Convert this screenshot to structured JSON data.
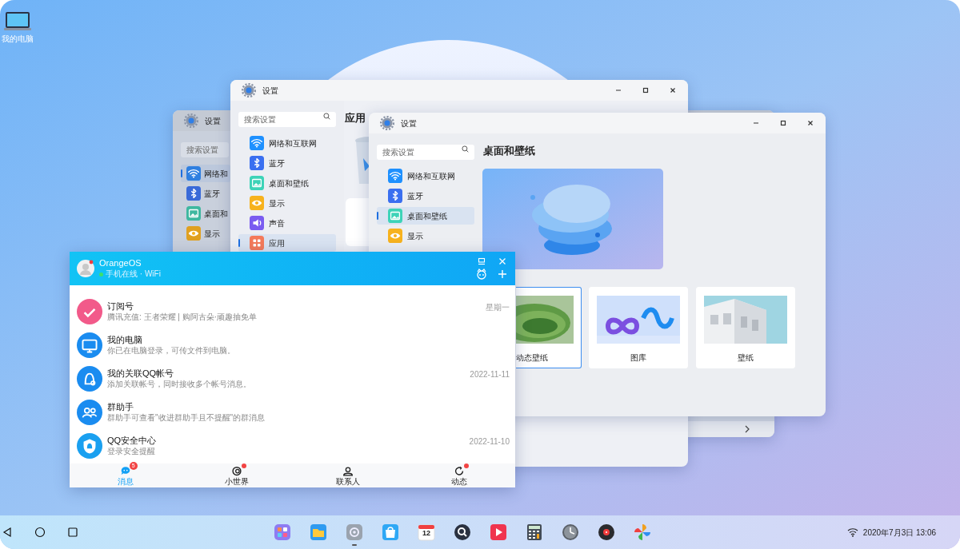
{
  "desktop_icons": [
    {
      "label": "我的电脑"
    }
  ],
  "windows": [
    {
      "title": "设置",
      "search": {
        "placeholder": "搜索设置"
      },
      "nav": [
        {
          "label": "网络和",
          "kind": "network",
          "color": "#2f7fe0",
          "selected": true
        },
        {
          "label": "蓝牙",
          "kind": "bluetooth",
          "color": "#3a6ad8",
          "selected": false
        },
        {
          "label": "桌面和",
          "kind": "wallpaper",
          "color": "#3fb8a0",
          "selected": false
        },
        {
          "label": "显示",
          "kind": "display",
          "color": "#e0a020",
          "selected": false
        }
      ],
      "footer": {
        "kind": "chevron"
      }
    },
    {
      "title": "设置",
      "search": {
        "placeholder": "搜索设置"
      },
      "nav": [
        {
          "label": "网络和互联网",
          "kind": "network",
          "color": "#1e90ff",
          "selected": false
        },
        {
          "label": "蓝牙",
          "kind": "bluetooth",
          "color": "#3a6ff0",
          "selected": false
        },
        {
          "label": "桌面和壁纸",
          "kind": "wallpaper",
          "color": "#3dd3b8",
          "selected": false
        },
        {
          "label": "显示",
          "kind": "display",
          "color": "#f7b21d",
          "selected": false
        },
        {
          "label": "声音",
          "kind": "sound",
          "color": "#7a5cf0",
          "selected": false
        },
        {
          "label": "应用",
          "kind": "apps",
          "color": "#f47a5a",
          "selected": true
        }
      ],
      "heading": "应用",
      "content": {
        "kind": "apps"
      }
    },
    {
      "title": "设置",
      "search": {
        "placeholder": "搜索设置"
      },
      "nav": [
        {
          "label": "网络和互联网",
          "kind": "network",
          "color": "#1e90ff",
          "selected": false
        },
        {
          "label": "蓝牙",
          "kind": "bluetooth",
          "color": "#3a6ff0",
          "selected": false
        },
        {
          "label": "桌面和壁纸",
          "kind": "wallpaper",
          "color": "#3dd3b8",
          "selected": true
        },
        {
          "label": "显示",
          "kind": "display",
          "color": "#f7b21d",
          "selected": false
        }
      ],
      "heading": "桌面和壁纸",
      "content": {
        "kind": "wallpaper",
        "cards": [
          {
            "label": "动态壁纸",
            "selected": true
          },
          {
            "label": "图库",
            "selected": false
          },
          {
            "label": "壁纸",
            "selected": false
          }
        ]
      }
    }
  ],
  "chat": {
    "profile": {
      "name": "OrangeOS",
      "status": "手机在线 · WiFi",
      "online": true
    },
    "conversations": [
      {
        "title": "订阅号",
        "preview": "腾讯充值: 王者荣耀 | 购阿古朵·顽趣抽免单",
        "time": "星期一",
        "kind": "subscription",
        "color": "#f25a8a"
      },
      {
        "title": "我的电脑",
        "preview": "你已在电脑登录，可传文件到电脑。",
        "kind": "computer",
        "color": "#1a8cf0"
      },
      {
        "title": "我的关联QQ帐号",
        "preview": "添加关联帐号，同时接收多个帐号消息。",
        "time": "2022-11-11",
        "kind": "linked",
        "color": "#1a8cf0"
      },
      {
        "title": "群助手",
        "preview": "群助手可查看\"收进群助手且不提醒\"的群消息",
        "kind": "group",
        "color": "#1a8cf0"
      },
      {
        "title": "QQ安全中心",
        "preview": "登录安全提醒",
        "time": "2022-11-10",
        "kind": "security",
        "color": "#1aa0f0"
      }
    ],
    "tabs": [
      {
        "label": "消息",
        "kind": "messages",
        "selected": true,
        "badge": "5",
        "dot": false
      },
      {
        "label": "小世界",
        "kind": "world",
        "selected": false,
        "dot": true
      },
      {
        "label": "联系人",
        "kind": "contacts",
        "selected": false,
        "dot": false
      },
      {
        "label": "动态",
        "kind": "feed",
        "selected": false,
        "dot": true
      }
    ]
  },
  "taskbar": {
    "apps": [
      {
        "kind": "launcher",
        "running": false
      },
      {
        "kind": "files",
        "running": false
      },
      {
        "kind": "settings",
        "running": true
      },
      {
        "kind": "store",
        "running": false
      },
      {
        "kind": "calendar",
        "text": "12",
        "running": false
      },
      {
        "kind": "search",
        "running": false
      },
      {
        "kind": "video",
        "running": false
      },
      {
        "kind": "calculator",
        "running": false
      },
      {
        "kind": "clock",
        "running": false
      },
      {
        "kind": "music",
        "running": false
      },
      {
        "kind": "photos",
        "running": false
      }
    ],
    "clock": "2020年7月3日 13:06"
  }
}
